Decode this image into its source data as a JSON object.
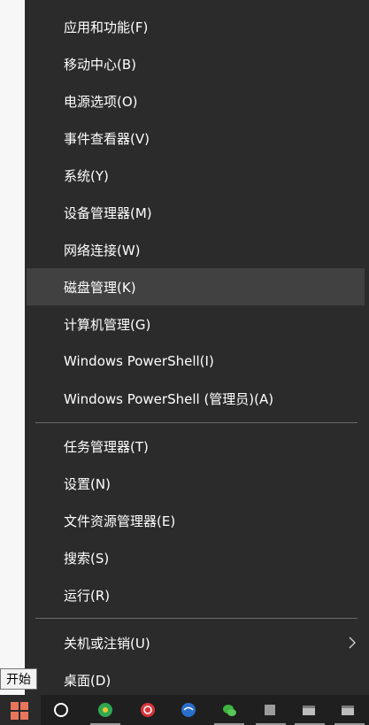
{
  "menu": {
    "items": [
      {
        "label": "应用和功能(F)"
      },
      {
        "label": "移动中心(B)"
      },
      {
        "label": "电源选项(O)"
      },
      {
        "label": "事件查看器(V)"
      },
      {
        "label": "系统(Y)"
      },
      {
        "label": "设备管理器(M)"
      },
      {
        "label": "网络连接(W)"
      },
      {
        "label": "磁盘管理(K)"
      },
      {
        "label": "计算机管理(G)"
      },
      {
        "label": "Windows PowerShell(I)"
      },
      {
        "label": "Windows PowerShell (管理员)(A)"
      },
      {
        "label": "任务管理器(T)"
      },
      {
        "label": "设置(N)"
      },
      {
        "label": "文件资源管理器(E)"
      },
      {
        "label": "搜索(S)"
      },
      {
        "label": "运行(R)"
      },
      {
        "label": "关机或注销(U)"
      },
      {
        "label": "桌面(D)"
      }
    ]
  },
  "tooltip": {
    "text": "开始"
  },
  "colors": {
    "menu_background": "#2b2b2b",
    "hover_background": "#414141",
    "separator": "#6a6a6a",
    "taskbar": "#1f1f1f"
  },
  "icons": {
    "start": "windows-logo-icon",
    "submenu": "chevron-right-icon"
  }
}
